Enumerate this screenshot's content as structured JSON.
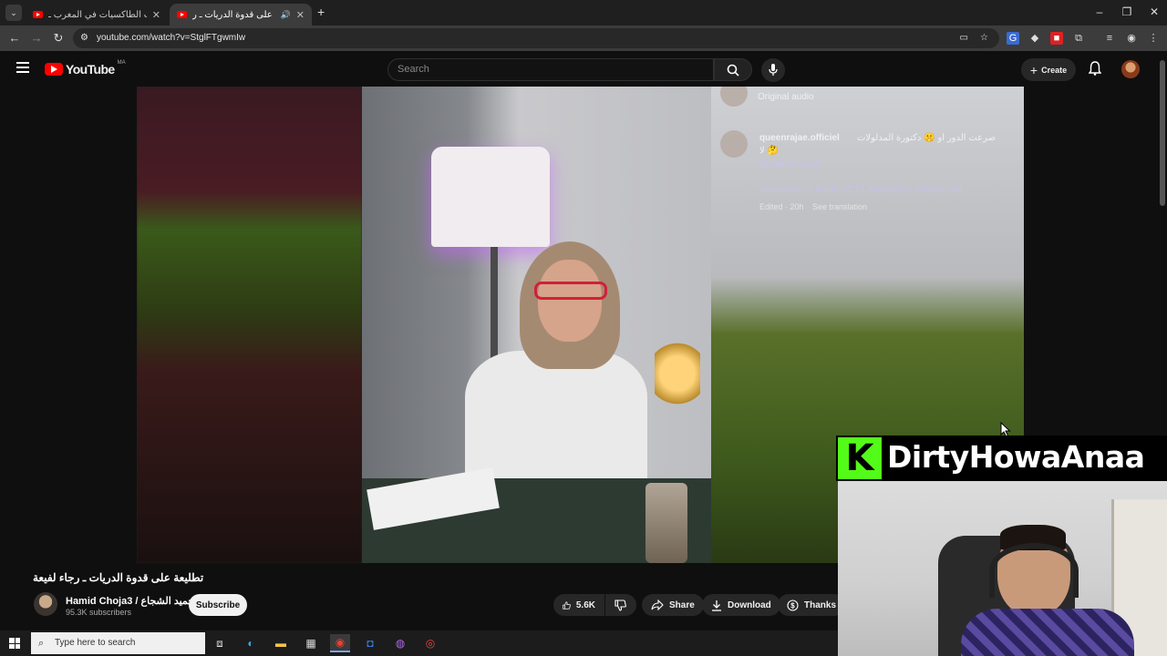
{
  "browser": {
    "tabs": [
      {
        "title": "اتجاهات الطاكسيات في المغرب ـ",
        "active": false
      },
      {
        "title": "تطليعة على قدوة الدريات ـ ر",
        "active": true
      }
    ],
    "new_tab": "+",
    "url": "youtube.com/watch?v=StglFTgwmIw"
  },
  "youtube": {
    "logo_text": "YouTube",
    "region": "MA",
    "search_placeholder": "Search",
    "create_label": "Create"
  },
  "video_overlay": {
    "audio_label": "Original audio",
    "username": "queenrajae.officiel",
    "caption_line1": "صرعت الدور او 🤫 دكتورة المدلولات",
    "caption_line2": "لا 🤔",
    "mention": "@realmemaroc",
    "hashtags": "realmeMaroc #realmeC71 #bigbattery #Makeitreal",
    "edited": "Edited · 20h",
    "see_translation": "See translation"
  },
  "video": {
    "title": "تطليعة على قدوة الدريات ـ رجاء لفيعة",
    "channel_name": "Hamid Choja3 / حميد الشجاع",
    "subscribers": "95.3K subscribers",
    "subscribe_label": "Subscribe",
    "likes": "5.6K",
    "share_label": "Share",
    "download_label": "Download",
    "thanks_label": "Thanks"
  },
  "webcam": {
    "platform_letter": "K",
    "streamer_name": "DirtyHowaAnaa",
    "brand_color": "#53fc18"
  },
  "taskbar": {
    "search_placeholder": "Type here to search"
  }
}
